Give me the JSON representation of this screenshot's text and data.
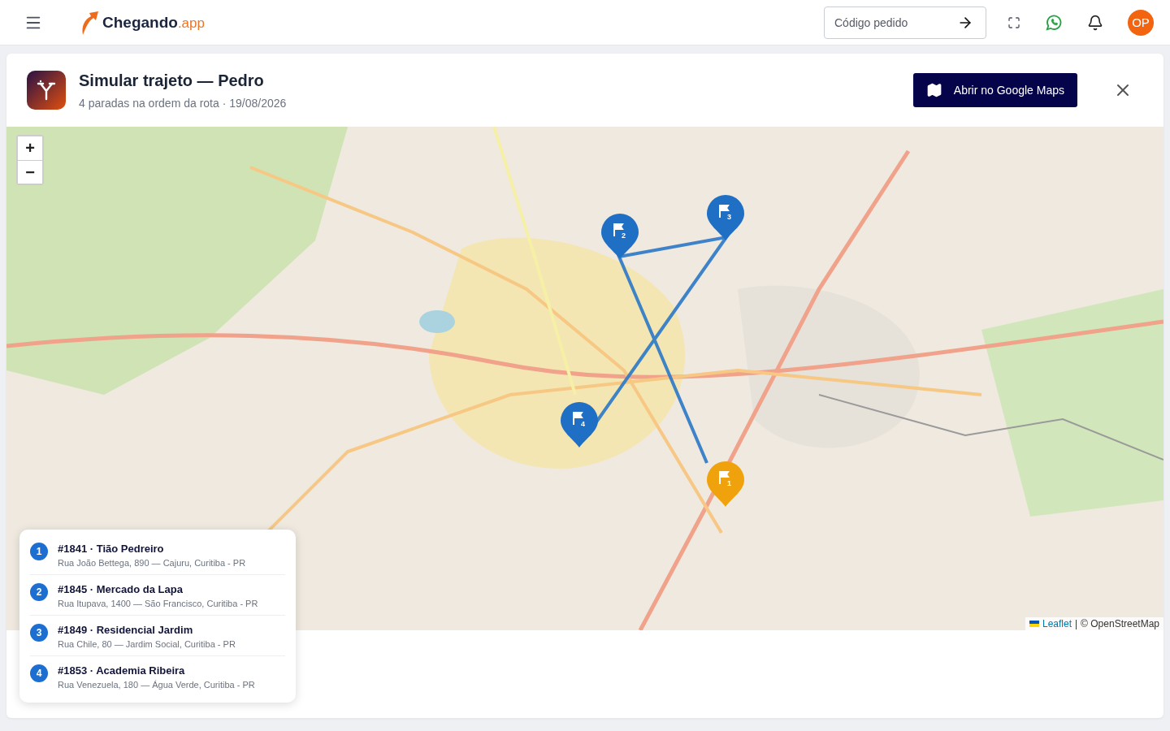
{
  "header": {
    "logo_name": "Chegando",
    "logo_suffix": ".app",
    "search": {
      "placeholder": "Código pedido"
    },
    "avatar": "OP"
  },
  "dialog": {
    "title": "Simular trajeto — Pedro",
    "subtitle": "4 paradas na ordem da rota · 19/08/2026",
    "maps_button": "Abrir no Google Maps"
  },
  "map": {
    "zoom_in": "+",
    "zoom_out": "−",
    "attribution": {
      "link": "Leaflet",
      "separator": "|",
      "credit": "© OpenStreetMap"
    },
    "stops": [
      {
        "number": "1",
        "pin_number": "1",
        "title": "#1841 · Tião Pedreiro",
        "address": "Rua João Bettega, 890 — Cajuru, Curitiba - PR",
        "color": "#f0a20c"
      },
      {
        "number": "2",
        "pin_number": "2",
        "title": "#1845 · Mercado da Lapa",
        "address": "Rua Itupava, 1400 — São Francisco, Curitiba - PR",
        "color": "#1f6fc5"
      },
      {
        "number": "3",
        "pin_number": "3",
        "title": "#1849 · Residencial Jardim",
        "address": "Rua Chile, 80 — Jardim Social, Curitiba - PR",
        "color": "#1f6fc5"
      },
      {
        "number": "4",
        "pin_number": "4",
        "title": "#1853 · Academia Ribeira",
        "address": "Rua Venezuela, 180 — Água Verde, Curitiba - PR",
        "color": "#1f6fc5"
      }
    ]
  }
}
